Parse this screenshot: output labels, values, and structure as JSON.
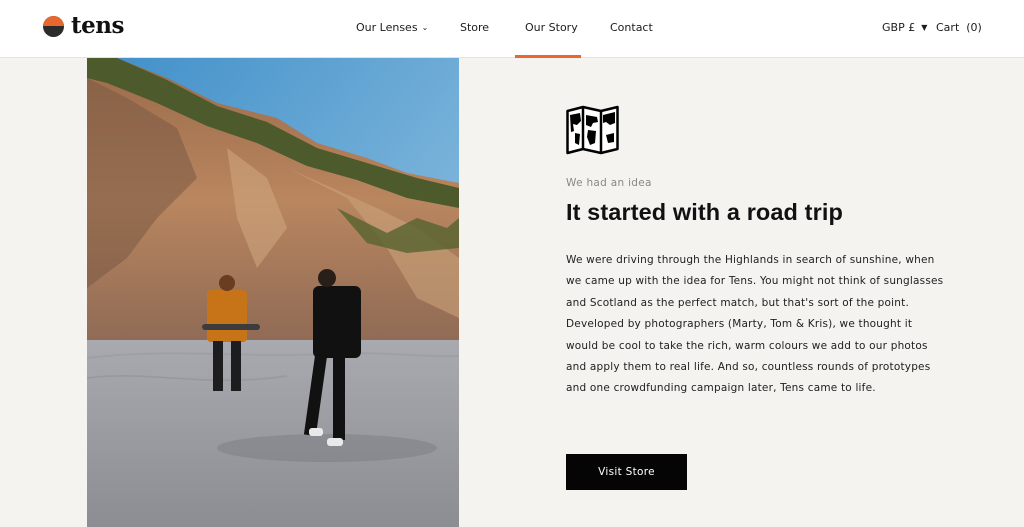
{
  "brand": {
    "name": "tens",
    "accent_color": "#e8672e"
  },
  "nav": {
    "items": [
      {
        "label": "Our Lenses",
        "has_dropdown": true
      },
      {
        "label": "Store"
      },
      {
        "label": "Our Story",
        "active": true
      },
      {
        "label": "Contact"
      }
    ]
  },
  "header": {
    "currency": "GBP £",
    "cart_label": "Cart",
    "cart_count": "(0)"
  },
  "hero": {
    "icon": "world-map-icon",
    "eyebrow": "We had an idea",
    "title": "It started with a road trip",
    "body": "We were driving through the Highlands in search of sunshine, when we came up with the idea for Tens. You might not think of sunglasses and Scotland as the perfect match, but that's sort of the point. Developed by photographers (Marty, Tom & Kris), we thought it would be cool to take the rich, warm colours we add to our photos and apply them to real life. And so, countless rounds of prototypes and one crowdfunding campaign later, Tens came to life.",
    "button_label": "Visit Store"
  }
}
